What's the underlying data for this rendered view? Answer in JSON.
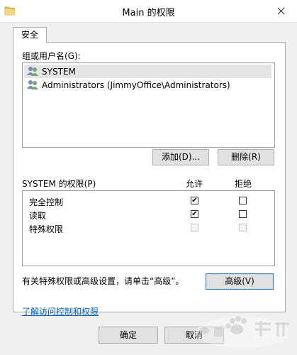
{
  "window": {
    "title": "Main 的权限"
  },
  "tabs": [
    {
      "label": "安全"
    }
  ],
  "groups": {
    "label": "组或用户名(G):",
    "items": [
      {
        "name": "SYSTEM",
        "selected": true
      },
      {
        "name": "Administrators (JimmyOffice\\Administrators)",
        "selected": false
      }
    ],
    "add_label": "添加(D)...",
    "remove_label": "删除(R)"
  },
  "permissions": {
    "header": "SYSTEM 的权限(P)",
    "allow_header": "允许",
    "deny_header": "拒绝",
    "rows": [
      {
        "name": "完全控制",
        "allow": true,
        "deny": false,
        "disabled": false
      },
      {
        "name": "读取",
        "allow": true,
        "deny": false,
        "disabled": false
      },
      {
        "name": "特殊权限",
        "allow": false,
        "deny": false,
        "disabled": true
      }
    ]
  },
  "advanced": {
    "hint": "有关特殊权限或高级设置，请单击“高级”。",
    "button_label": "高级(V)"
  },
  "link_text": "了解访问控制和权限",
  "footer": {
    "ok_label": "确定",
    "cancel_label": "取消"
  },
  "colors": {
    "link": "#0066cc",
    "selected_row": "#e5e5e5",
    "focus_border": "#3c7fb1"
  },
  "icons": {
    "app": "folder-icon",
    "close": "close-icon",
    "user": "user-group-icon"
  }
}
